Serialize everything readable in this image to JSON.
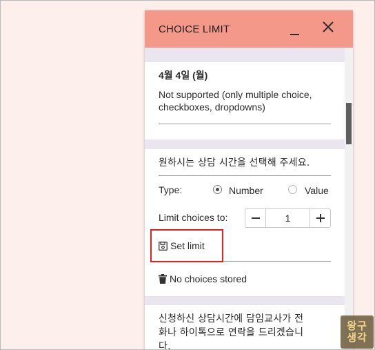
{
  "panel": {
    "title": "CHOICE LIMIT"
  },
  "card1": {
    "title": "4월 4일 (월)",
    "message": "Not supported (only multiple choice, checkboxes, dropdowns)",
    "message_line1": "Not supported (only multiple choice,",
    "message_line2": "checkboxes, dropdowns)"
  },
  "card2": {
    "question": "원하시는 상담 시간을 선택해 주세요.",
    "type_label": "Type:",
    "type_options": [
      "Number",
      "Value"
    ],
    "type_selected": "Number",
    "limit_label": "Limit choices to:",
    "limit_value": "1",
    "set_limit_label": "Set limit",
    "no_choices_label": "No choices stored"
  },
  "card3": {
    "question_line1": "신청하신 상담시간에 담임교사가 전",
    "question_line2": "화나 하이톡으로 연락을 드리겠습니",
    "question_line3": "다."
  },
  "watermark": {
    "line1": "왕구",
    "line2": "생각"
  },
  "colors": {
    "header": "#f4998a",
    "background": "#fdefec",
    "body_band": "#ebe5f0",
    "highlight": "#e41f1f"
  }
}
